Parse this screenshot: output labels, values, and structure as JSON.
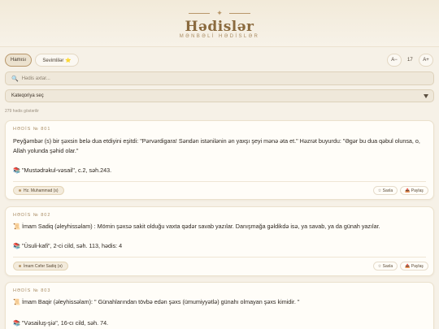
{
  "header": {
    "title": "Hədislər",
    "subtitle": "MƏNBƏLİ HƏDİSLƏR",
    "ornament": "✦"
  },
  "filters": {
    "all_label": "Hamısı",
    "favorites_label": "Sevimlilər ⭐"
  },
  "font_controls": {
    "decrease": "A−",
    "size": "17",
    "increase": "A+"
  },
  "search": {
    "icon": "🔍",
    "placeholder": "Hədis axtar..."
  },
  "category": {
    "selected": "Kateqoriya seç"
  },
  "count_text": "279 hədis göstərilir",
  "cards": [
    {
      "number": "HƏDİS № 801",
      "text": "Peyğəmbər (s) bir şəxsin belə dua etdiyini eşitdi: \"Pərvərdigara! Səndən istənilənin ən yaxşı şeyi mənə əta et.\" Həzrət buyurdu: \"Əgər bu dua qəbul olunsa, o, Allah yolunda şəhid olar.\"",
      "source": "📚 \"Mustədrəkul-vəsail\", c.2, səh.243.",
      "narrator": "Hz. Muhammad (s)",
      "save": "☆ Saxla",
      "share": "📤 Paylaş"
    },
    {
      "number": "HƏDİS № 802",
      "text": "📜 İmam Sadiq (əleyhissəlam) : Mömin şəxsə sakit olduğu vaxta qədər savab yazılar. Danışmağa gəldikdə isə, ya savab, ya da günah yazılar.",
      "source": "📚 \"Üsuli-kafi\", 2-ci cild, səh. 113, hədis: 4",
      "narrator": "İmam Cəfər Sadiq (ə)",
      "save": "☆ Saxla",
      "share": "📤 Paylaş"
    },
    {
      "number": "HƏDİS № 803",
      "text": "📜 İmam Baqir (əleyhissəlam): \" Günahlarından tövbə edən şəxs (ümumiyyətlə) günahı olmayan şəxs kimidir. \"",
      "source": "📚 \"Vəsailuş-şiə\", 16-cı cild, səh. 74."
    }
  ],
  "colors": {
    "accent": "#b8976a",
    "title": "#8a6a3e",
    "background": "#f6f1e7",
    "card": "#fffdf8"
  }
}
